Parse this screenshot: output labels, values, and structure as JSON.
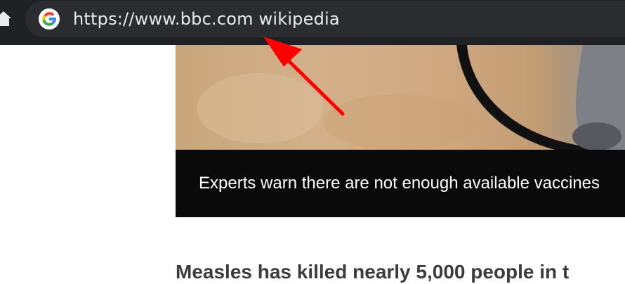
{
  "browser": {
    "address_bar": {
      "favicon": "google-g-icon",
      "text": "https://www.bbc.com wikipedia"
    },
    "home_icon": "home-icon",
    "toolbar_color": "#202124"
  },
  "article": {
    "image_caption": "Experts warn there are not enough available vaccines",
    "headline": "Measles has killed nearly 5,000 people in t"
  },
  "annotation": {
    "icon": "red-arrow-icon",
    "color": "#ff0000"
  }
}
